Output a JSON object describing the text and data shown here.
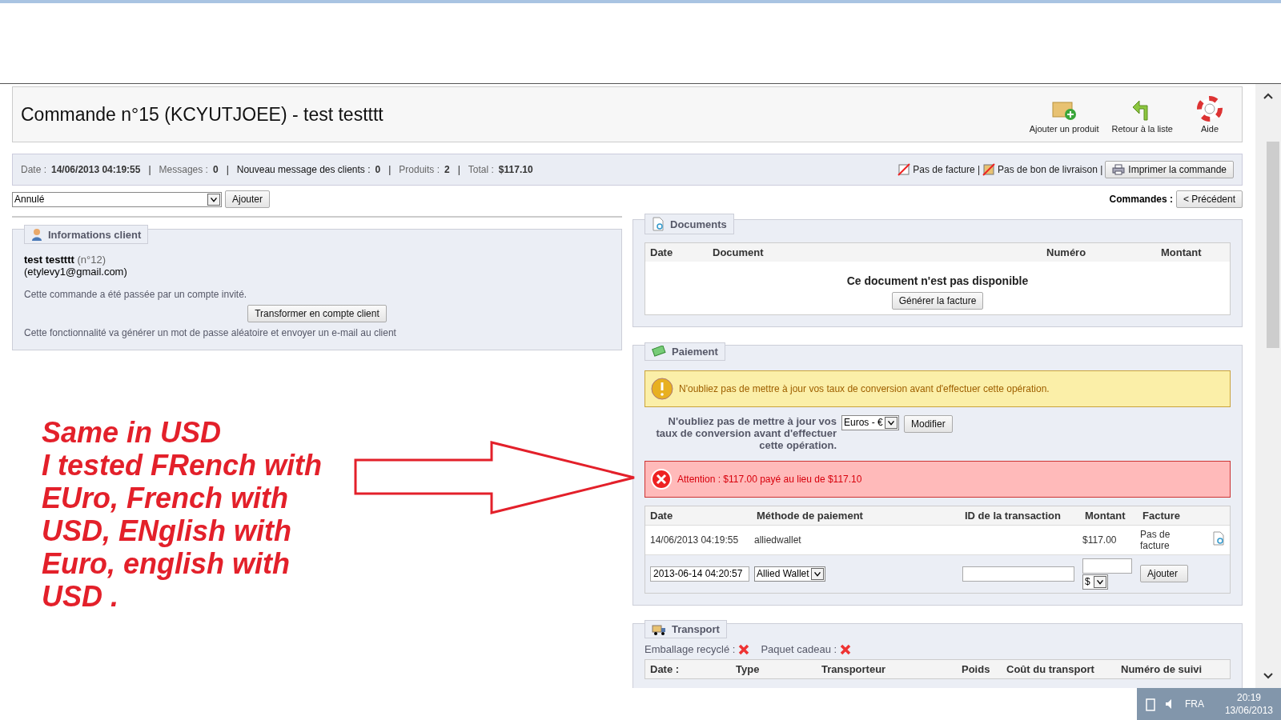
{
  "header": {
    "title": "Commande n°15 (KCYUTJOEE) - test testttt",
    "actions": [
      {
        "kind": "add",
        "label": "Ajouter un produit"
      },
      {
        "kind": "back",
        "label": "Retour à la liste"
      },
      {
        "kind": "help",
        "label": "Aide"
      }
    ]
  },
  "summary": {
    "items": [
      {
        "label": "Date :",
        "value": "14/06/2013 04:19:55",
        "separator": "|",
        "emphasis": false
      },
      {
        "label": "Messages :",
        "value": "0",
        "separator": "|",
        "emphasis": false
      },
      {
        "label": "Nouveau message des clients :",
        "value": "0",
        "separator": "|",
        "emphasis": true
      },
      {
        "label": "Produits :",
        "value": "2",
        "separator": "|",
        "emphasis": false
      },
      {
        "label": "Total :",
        "value": "$117.10",
        "emphasis": false
      }
    ],
    "documents": [
      {
        "kind": "invoice",
        "label": "Pas de facture |"
      },
      {
        "kind": "delivery",
        "label": "Pas de bon de livraison |"
      }
    ],
    "print_button": "Imprimer la commande"
  },
  "status": {
    "value": "Annulé",
    "button": "Ajouter"
  },
  "navigation": {
    "label": "Commandes :",
    "previous": "< Précédent"
  },
  "client": {
    "title": "Informations client",
    "name": "test testttt",
    "number": "(n°12)",
    "email": "(etylevy1@gmail.com)",
    "guest_note": "Cette commande a été passée par un compte invité.",
    "button": "Transformer en compte client",
    "note": "Cette fonctionnalité va générer un mot de passe aléatoire et envoyer un e-mail au client"
  },
  "documents": {
    "title": "Documents",
    "columns": [
      "Date",
      "Document",
      "Numéro",
      "Montant"
    ],
    "empty": "Ce document n'est pas disponible",
    "button": "Générer la facture"
  },
  "payment": {
    "title": "Paiement",
    "warning": "N'oubliez pas de mettre à jour vos taux de conversion avant d'effectuer cette opération.",
    "conversion_label": "N'oubliez pas de mettre à jour vos taux de conversion avant d'effectuer cette opération.",
    "currency": "Euros - €",
    "modify_button": "Modifier",
    "error": "Attention : $117.00 payé au lieu de $117.10",
    "columns": [
      "Date",
      "Méthode de paiement",
      "ID de la transaction",
      "Montant",
      "Facture"
    ],
    "rows": [
      {
        "date": "14/06/2013 04:19:55",
        "method": "alliedwallet",
        "amount": "$117.00",
        "invoice": "Pas de facture"
      }
    ],
    "form": {
      "date": "2013-06-14 04:20:57",
      "method": "Allied Wallet",
      "currency": "$",
      "button": "Ajouter"
    }
  },
  "transport": {
    "title": "Transport",
    "flags": [
      {
        "label": "Emballage recyclé :",
        "enabled": false
      },
      {
        "label": "Paquet cadeau :",
        "enabled": false
      }
    ],
    "columns": [
      "Date :",
      "Type",
      "Transporteur",
      "Poids",
      "Coût du transport",
      "Numéro de suivi"
    ]
  },
  "annotation": {
    "lines": [
      "Same in USD",
      "I tested FRench with",
      "EUro, French with",
      "USD, ENglish with",
      "Euro, english with",
      "USD ."
    ]
  },
  "taskbar": {
    "language": "FRA",
    "time": "20:19",
    "date": "13/06/2013"
  }
}
